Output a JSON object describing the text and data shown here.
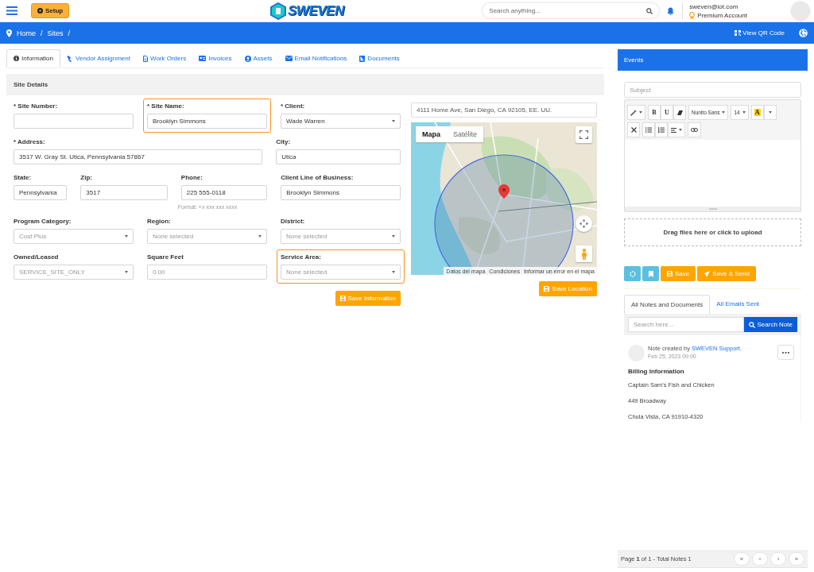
{
  "topbar": {
    "setup_button": "Setup",
    "logo": "SWEVEN",
    "search": {
      "placeholder": "Search anything..."
    },
    "user": {
      "email": "sweven@iot.com",
      "account": "Premium Account"
    }
  },
  "breadcrumb": {
    "items": [
      "Home",
      "Sites"
    ],
    "separator": "/",
    "qr_button": "View QR Code"
  },
  "tabs": [
    {
      "label": "Information",
      "selected": true
    },
    {
      "label": "Vendor Assignment",
      "selected": false
    },
    {
      "label": "Work Orders",
      "selected": false
    },
    {
      "label": "Invoices",
      "selected": false
    },
    {
      "label": "Assets",
      "selected": false
    },
    {
      "label": "Email Notifications",
      "selected": false
    },
    {
      "label": "Documents",
      "selected": false
    }
  ],
  "section_title": "Site Details",
  "form_rows": [
    [
      {
        "label": "* Site Number:",
        "kind": "text",
        "highlighted": false
      },
      {
        "label": "* Site Name:",
        "kind": "text",
        "value": "Brooklyn Simmons",
        "highlighted": true
      },
      {
        "label": "* Client:",
        "kind": "select",
        "value": "Wade Warren",
        "highlighted": false
      }
    ],
    [
      {
        "label": "* Address:",
        "kind": "text",
        "value": "3517 W. Gray St. Utica, Pennsylvania 57867",
        "highlighted": false
      },
      {
        "label": "City:",
        "kind": "text",
        "value": "Utica",
        "highlighted": false
      }
    ],
    [
      {
        "label": "State:",
        "kind": "text",
        "value": "Pennsylvania",
        "highlighted": false
      },
      {
        "label": "Zip:",
        "kind": "text",
        "value": "3517",
        "highlighted": false
      },
      {
        "label": "Phone:",
        "kind": "text",
        "value": "225 555-0118",
        "hint": "Format: +x xxx xxx xxxx",
        "highlighted": false
      },
      {
        "label": "Client Line of Business:",
        "kind": "text",
        "value": "Brooklyn Simmons",
        "highlighted": false
      }
    ],
    [
      {
        "label": "Program Category:",
        "kind": "select",
        "placeholder": "Cost Plus",
        "highlighted": false
      },
      {
        "label": "Region:",
        "kind": "select",
        "placeholder": "None selected",
        "highlighted": false
      },
      {
        "label": "District:",
        "kind": "select",
        "placeholder": "None selected",
        "highlighted": false
      }
    ],
    [
      {
        "label": "Owned/Leased",
        "kind": "select",
        "placeholder": "SERVICE_SITE_ONLY",
        "highlighted": false
      },
      {
        "label": "Square Feet",
        "kind": "text",
        "placeholder": "0.00",
        "highlighted": false
      },
      {
        "label": "Service Area:",
        "kind": "select",
        "placeholder": "None selected",
        "highlighted": true
      }
    ]
  ],
  "save_information": "Save Information",
  "map": {
    "address": "4111 Home Ave, San Diego, CA 92105, EE. UU.",
    "type_buttons": [
      {
        "label": "Mapa",
        "selected": true
      },
      {
        "label": "Satélite",
        "selected": false
      }
    ],
    "footer_links": [
      "Datos del mapa",
      "Condiciones",
      "Informar un error en el mapa"
    ],
    "save_button": "Save Location"
  },
  "events": {
    "title": "Events",
    "subject_placeholder": "Subject",
    "toolbar": {
      "bold": "B",
      "underline": "U",
      "font": "Nunito Sans",
      "size": "14",
      "text_color_label": "A"
    },
    "dropzone": "Drag files here or click to upload",
    "actions": [
      "Save",
      "Save & Send"
    ]
  },
  "notes": {
    "tabs": [
      {
        "label": "All Notes and Documents",
        "selected": true
      },
      {
        "label": "All Emails Sent",
        "selected": false
      }
    ],
    "search_placeholder": "Search here...",
    "search_button": "Search Note",
    "items": [
      {
        "prefix": "Note created by",
        "author": "SWEVEN Support.",
        "date": "Feb 25, 2023 09:00",
        "title": "Billing Information",
        "lines": [
          "Captain Sam's Fish and Chicken",
          "449 Broadway",
          "Chula Vista, CA 91910-4320"
        ]
      }
    ],
    "pagination": {
      "summary": "Page **1** of 1 - Total Notes 1",
      "buttons": [
        "«",
        "‹",
        "›",
        "»"
      ]
    }
  }
}
